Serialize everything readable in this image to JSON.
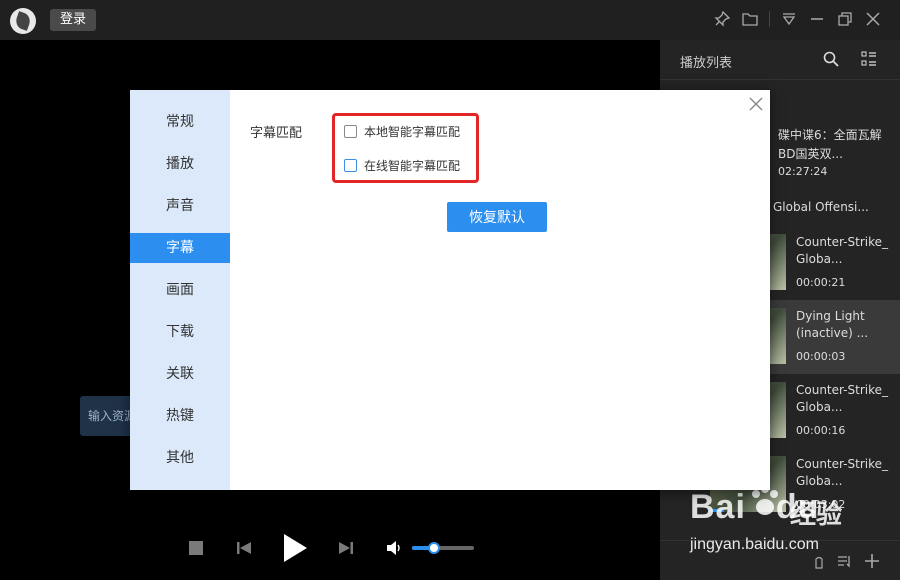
{
  "topbar": {
    "login_label": "登录"
  },
  "player": {
    "input_hint": "输入资源",
    "volume_level": 0.35
  },
  "playlist": {
    "title": "播放列表",
    "featured": {
      "title": "碟中谍6：全面瓦解BD国英双...",
      "duration": "02:27:24"
    },
    "group_label": "Global Offensi...",
    "items": [
      {
        "title": "Counter-Strike_ Globa...",
        "duration": "00:00:21",
        "active": false
      },
      {
        "title": "Dying Light (inactive) ...",
        "duration": "00:00:03",
        "active": true
      },
      {
        "title": "Counter-Strike_ Globa...",
        "duration": "00:00:16",
        "active": false
      },
      {
        "title": "Counter-Strike_ Globa...",
        "duration": "00:03:02",
        "active": false
      }
    ]
  },
  "dialog": {
    "nav": [
      "常规",
      "播放",
      "声音",
      "字幕",
      "画面",
      "下载",
      "关联",
      "热键",
      "其他"
    ],
    "active_nav": 3,
    "section_label": "字幕匹配",
    "options": {
      "local": "本地智能字幕匹配",
      "online": "在线智能字幕匹配"
    },
    "restore_label": "恢复默认"
  },
  "watermark": {
    "brand": "Bai",
    "brand2": "du",
    "jingyan": "经验",
    "url": "jingyan.baidu.com"
  },
  "colors": {
    "accent": "#2c8ff0",
    "highlight": "#e42525",
    "nav_bg": "#dbe9fa"
  }
}
